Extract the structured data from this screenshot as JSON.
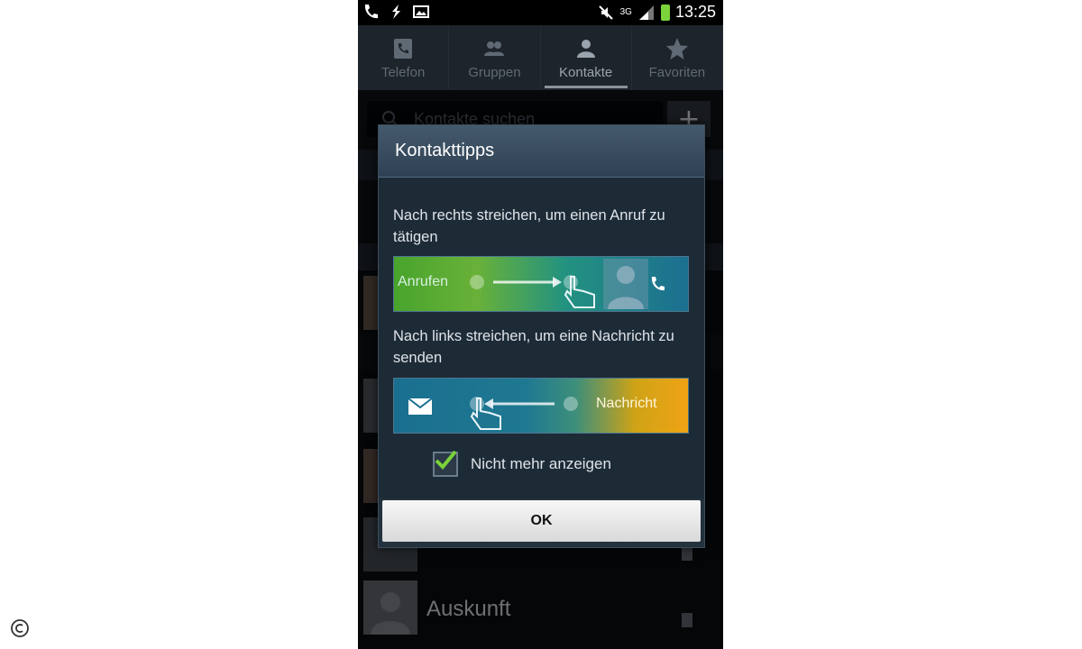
{
  "statusbar": {
    "time": "13:25",
    "network": "3G"
  },
  "tabs": [
    {
      "label": "Telefon",
      "icon": "phone-icon"
    },
    {
      "label": "Gruppen",
      "icon": "groups-icon"
    },
    {
      "label": "Kontakte",
      "icon": "contact-icon",
      "active": true
    },
    {
      "label": "Favoriten",
      "icon": "star-icon"
    }
  ],
  "search": {
    "placeholder": "Kontakte suchen"
  },
  "background_contacts": [
    {
      "name": "Auskunft"
    }
  ],
  "dialog": {
    "title": "Kontakttipps",
    "tip_call": "Nach rechts streichen, um einen Anruf zu tätigen",
    "call_label": "Anrufen",
    "tip_message": "Nach links streichen, um eine Nachricht zu senden",
    "message_label": "Nachricht",
    "checkbox_label": "Nicht mehr anzeigen",
    "checkbox_checked": true,
    "ok_label": "OK"
  },
  "colors": {
    "call_green": "#48a42d",
    "message_orange": "#f0a315",
    "dialog_bg": "#1d2b37",
    "accent_check": "#7ad33a"
  }
}
